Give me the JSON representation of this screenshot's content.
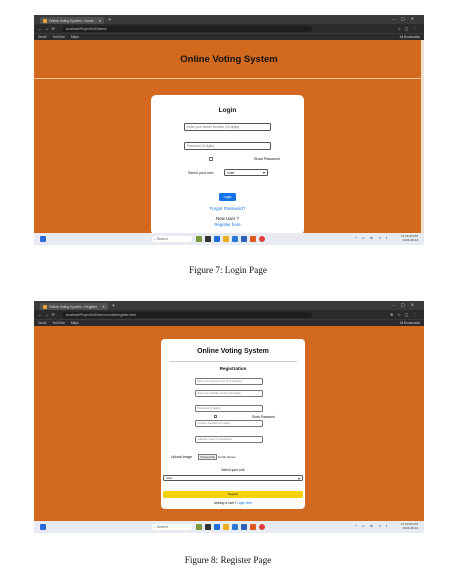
{
  "screenshot1": {
    "tab_title": "Online Voting System - Home",
    "url": "localhost/Project%20demo/",
    "bookmarks": [
      "Gmail",
      "YouTube",
      "Maps"
    ],
    "all_bookmarks": "All Bookmarks",
    "page_title": "Online Voting System",
    "card_heading": "Login",
    "mobile_placeholder": "Enter your Mobile Number (10 digits)",
    "password_placeholder": "Password (5 digits)",
    "show_password": "Show Password",
    "role_label": "Select your role:",
    "role_value": "Voter",
    "login_button": "Login",
    "forgot_link": "Forgot Password?",
    "new_user": "New User ?",
    "register_link": "Register here",
    "taskbar_search": "Search",
    "clock_time": "12:35:45 PM",
    "clock_date": "2024-08-24"
  },
  "screenshot2": {
    "tab_title": "Online Voting System - Register",
    "url": "localhost/Project%20demo/routes/register.html",
    "bookmarks": [
      "Gmail",
      "YouTube",
      "Maps"
    ],
    "all_bookmarks": "All Bookmarks",
    "page_title": "Online Voting System",
    "section_heading": "Registration",
    "name_placeholder": "Enter your Name (max 76 characters)",
    "mobile_placeholder": "Enter your Mobile number (10 digits)",
    "password_placeholder": "Password (4 digits)",
    "show_password": "Show Password",
    "confirm_placeholder": "Confirm Password (4 digits)",
    "address_placeholder": "Address (max 76 characters)",
    "upload_label": "Upload Image",
    "choose_file": "Choose File",
    "no_file": "No file chosen",
    "role_label": "Select your role",
    "role_value": "Voter",
    "register_button": "Register",
    "already_user": "Already a user?",
    "login_link": "Login here",
    "taskbar_search": "Search",
    "clock_time": "12:34:59 PM",
    "clock_date": "2024-08-24"
  },
  "captions": {
    "fig7": "Figure 7: Login Page",
    "fig8": "Figure 8: Register Page"
  },
  "colors": {
    "page_bg": "#d2691e",
    "link_blue": "#1473e6",
    "register_yellow": "#f5d20a"
  }
}
